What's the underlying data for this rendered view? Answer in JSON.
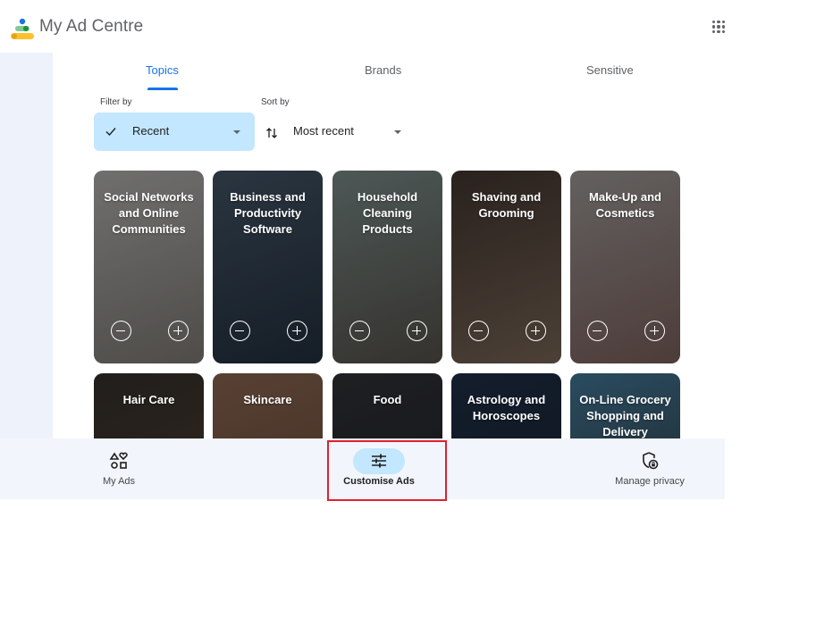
{
  "header": {
    "app_title": "My Ad Centre",
    "logo_icon": "my-ad-centre-logo",
    "apps_icon": "google-apps-grid-icon"
  },
  "tabs": [
    {
      "label": "Topics",
      "active": true
    },
    {
      "label": "Brands",
      "active": false
    },
    {
      "label": "Sensitive",
      "active": false
    }
  ],
  "filter": {
    "label": "Filter by",
    "value": "Recent",
    "icon": "check-icon"
  },
  "sort": {
    "label": "Sort by",
    "value": "Most recent",
    "icon": "sort-arrows-icon"
  },
  "cards": [
    {
      "title": "Social Networks and Online Communities",
      "colors": [
        "#9a9a98",
        "#6e6a66"
      ]
    },
    {
      "title": "Business and Productivity Software",
      "colors": [
        "#3b4a5a",
        "#1e2a36"
      ]
    },
    {
      "title": "Household Cleaning Products",
      "colors": [
        "#6b7a78",
        "#4a4640"
      ]
    },
    {
      "title": "Shaving and Grooming",
      "colors": [
        "#3a2f2a",
        "#6a5a4c"
      ]
    },
    {
      "title": "Make-Up and Cosmetics",
      "colors": [
        "#8a8684",
        "#6b5450"
      ]
    },
    {
      "title": "Hair Care",
      "colors": [
        "#2e2a26",
        "#4a3a30"
      ]
    },
    {
      "title": "Skincare",
      "colors": [
        "#7a5a48",
        "#5a3e30"
      ]
    },
    {
      "title": "Food",
      "colors": [
        "#2a2c30",
        "#1c1e22"
      ]
    },
    {
      "title": "Astrology and Horoscopes",
      "colors": [
        "#1c2a3e",
        "#141c2a"
      ]
    },
    {
      "title": "On-Line Grocery Shopping and Delivery",
      "colors": [
        "#3a6a86",
        "#2a2c2e"
      ]
    }
  ],
  "card_actions": {
    "minus_icon": "minus-circle-icon",
    "plus_icon": "plus-circle-icon"
  },
  "bottom_nav": [
    {
      "label": "My Ads",
      "icon": "shapes-icon",
      "active": false
    },
    {
      "label": "Customise Ads",
      "icon": "sliders-icon",
      "active": true
    },
    {
      "label": "Manage privacy",
      "icon": "shield-lock-icon",
      "active": false
    }
  ],
  "colors": {
    "accent": "#1a73e8",
    "selected_fill": "#c2e7ff",
    "nav_bg": "#f2f6fc",
    "highlight": "#e0202e"
  }
}
